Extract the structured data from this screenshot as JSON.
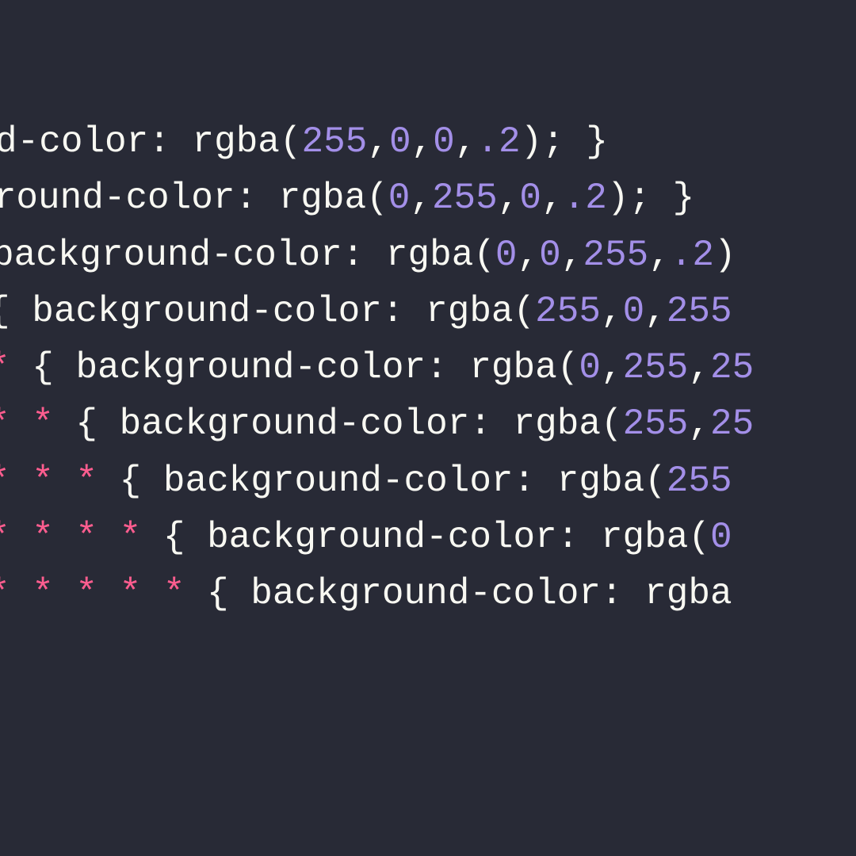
{
  "colors": {
    "bg": "#282a36",
    "text": "#f8f8f2",
    "selector": "#ff5d8f",
    "number": "#a38fe8"
  },
  "lines": [
    {
      "offset": -144,
      "tokens": [
        {
          "t": "ground-color",
          "c": "property"
        },
        {
          "t": ": ",
          "c": "punct"
        },
        {
          "t": "rgba",
          "c": "func"
        },
        {
          "t": "(",
          "c": "punct"
        },
        {
          "t": "255",
          "c": "number"
        },
        {
          "t": ",",
          "c": "punct"
        },
        {
          "t": "0",
          "c": "number"
        },
        {
          "t": ",",
          "c": "punct"
        },
        {
          "t": "0",
          "c": "number"
        },
        {
          "t": ",",
          "c": "punct"
        },
        {
          "t": ".2",
          "c": "number"
        },
        {
          "t": "); }",
          "c": "punct"
        }
      ]
    },
    {
      "offset": -90,
      "tokens": [
        {
          "t": "ckground-color",
          "c": "property"
        },
        {
          "t": ": ",
          "c": "punct"
        },
        {
          "t": "rgba",
          "c": "func"
        },
        {
          "t": "(",
          "c": "punct"
        },
        {
          "t": "0",
          "c": "number"
        },
        {
          "t": ",",
          "c": "punct"
        },
        {
          "t": "255",
          "c": "number"
        },
        {
          "t": ",",
          "c": "punct"
        },
        {
          "t": "0",
          "c": "number"
        },
        {
          "t": ",",
          "c": "punct"
        },
        {
          "t": ".2",
          "c": "number"
        },
        {
          "t": "); }",
          "c": "punct"
        }
      ]
    },
    {
      "offset": -10,
      "tokens": [
        {
          "t": "background-color",
          "c": "property"
        },
        {
          "t": ": ",
          "c": "punct"
        },
        {
          "t": "rgba",
          "c": "func"
        },
        {
          "t": "(",
          "c": "punct"
        },
        {
          "t": "0",
          "c": "number"
        },
        {
          "t": ",",
          "c": "punct"
        },
        {
          "t": "0",
          "c": "number"
        },
        {
          "t": ",",
          "c": "punct"
        },
        {
          "t": "255",
          "c": "number"
        },
        {
          "t": ",",
          "c": "punct"
        },
        {
          "t": ".2",
          "c": "number"
        },
        {
          "t": ")",
          "c": "punct"
        }
      ]
    },
    {
      "offset": -15,
      "tokens": [
        {
          "t": "{ ",
          "c": "punct"
        },
        {
          "t": "background-color",
          "c": "property"
        },
        {
          "t": ": ",
          "c": "punct"
        },
        {
          "t": "rgba",
          "c": "func"
        },
        {
          "t": "(",
          "c": "punct"
        },
        {
          "t": "255",
          "c": "number"
        },
        {
          "t": ",",
          "c": "punct"
        },
        {
          "t": "0",
          "c": "number"
        },
        {
          "t": ",",
          "c": "punct"
        },
        {
          "t": "255",
          "c": "number"
        }
      ]
    },
    {
      "offset": -15,
      "tokens": [
        {
          "t": "*",
          "c": "selector"
        },
        {
          "t": " { ",
          "c": "punct"
        },
        {
          "t": "background-color",
          "c": "property"
        },
        {
          "t": ": ",
          "c": "punct"
        },
        {
          "t": "rgba",
          "c": "func"
        },
        {
          "t": "(",
          "c": "punct"
        },
        {
          "t": "0",
          "c": "number"
        },
        {
          "t": ",",
          "c": "punct"
        },
        {
          "t": "255",
          "c": "number"
        },
        {
          "t": ",",
          "c": "punct"
        },
        {
          "t": "25",
          "c": "number"
        }
      ]
    },
    {
      "offset": -15,
      "tokens": [
        {
          "t": "* *",
          "c": "selector"
        },
        {
          "t": " { ",
          "c": "punct"
        },
        {
          "t": "background-color",
          "c": "property"
        },
        {
          "t": ": ",
          "c": "punct"
        },
        {
          "t": "rgba",
          "c": "func"
        },
        {
          "t": "(",
          "c": "punct"
        },
        {
          "t": "255",
          "c": "number"
        },
        {
          "t": ",",
          "c": "punct"
        },
        {
          "t": "25",
          "c": "number"
        }
      ]
    },
    {
      "offset": -15,
      "tokens": [
        {
          "t": "* * *",
          "c": "selector"
        },
        {
          "t": " { ",
          "c": "punct"
        },
        {
          "t": "background-color",
          "c": "property"
        },
        {
          "t": ": ",
          "c": "punct"
        },
        {
          "t": "rgba",
          "c": "func"
        },
        {
          "t": "(",
          "c": "punct"
        },
        {
          "t": "255",
          "c": "number"
        }
      ]
    },
    {
      "offset": -15,
      "tokens": [
        {
          "t": "* * * *",
          "c": "selector"
        },
        {
          "t": " { ",
          "c": "punct"
        },
        {
          "t": "background-color",
          "c": "property"
        },
        {
          "t": ": ",
          "c": "punct"
        },
        {
          "t": "rgba",
          "c": "func"
        },
        {
          "t": "(",
          "c": "punct"
        },
        {
          "t": "0",
          "c": "number"
        }
      ]
    },
    {
      "offset": -15,
      "tokens": [
        {
          "t": "* * * * *",
          "c": "selector"
        },
        {
          "t": " { ",
          "c": "punct"
        },
        {
          "t": "background-color",
          "c": "property"
        },
        {
          "t": ": ",
          "c": "punct"
        },
        {
          "t": "rgba",
          "c": "func"
        }
      ]
    }
  ]
}
